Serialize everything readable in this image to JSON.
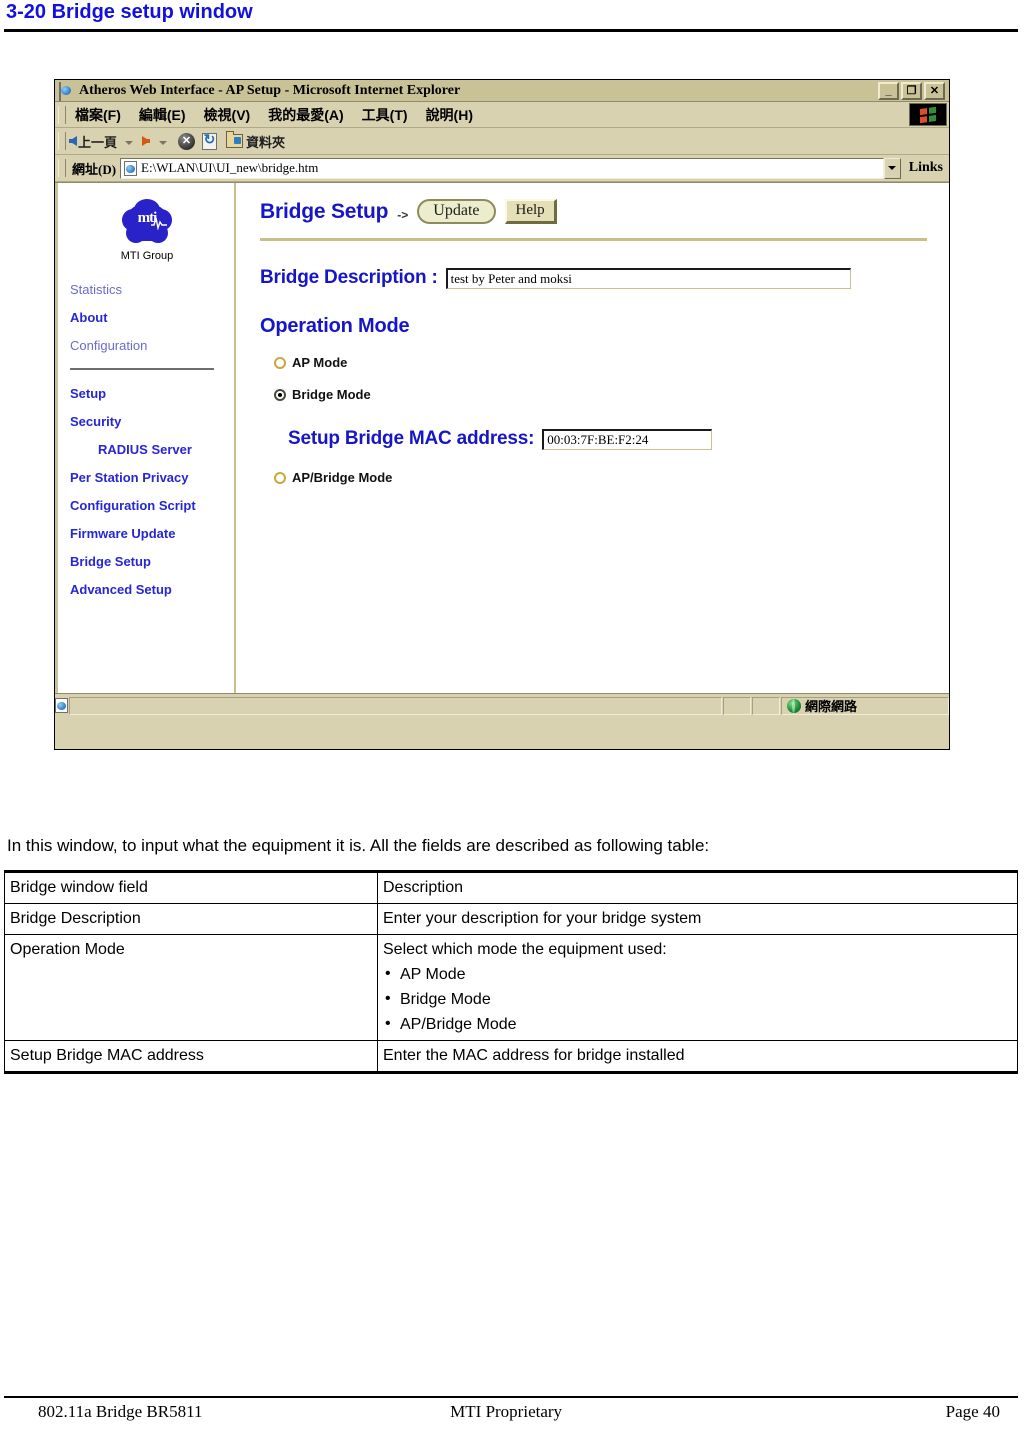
{
  "document": {
    "heading": "3-20 Bridge setup window",
    "intro": "In this window, to input what the equipment it is. All the fields are described as following table:"
  },
  "browser": {
    "title": "Atheros Web Interface - AP Setup - Microsoft Internet Explorer",
    "window_buttons": {
      "minimize": "_",
      "restore": "❐",
      "close": "✕"
    },
    "menu": [
      {
        "label": "檔案(F)"
      },
      {
        "label": "編輯(E)"
      },
      {
        "label": "檢視(V)"
      },
      {
        "label": "我的最愛(A)"
      },
      {
        "label": "工具(T)"
      },
      {
        "label": "說明(H)"
      }
    ],
    "toolbar": {
      "back_label": "上一頁",
      "forward_label": "",
      "stop_label": "✕",
      "refresh_label": "",
      "folders_label": "資料夾"
    },
    "address": {
      "label": "網址(D)",
      "value": "E:\\WLAN\\UI\\UI_new\\bridge.htm",
      "links_label": "Links"
    },
    "statusbar": {
      "zone": "網際網路"
    }
  },
  "sidebar": {
    "logo_text": "mti",
    "logo_label": "MTI Group",
    "items": [
      {
        "label": "Statistics",
        "style": "light"
      },
      {
        "label": "About",
        "style": "bold"
      },
      {
        "label": "Configuration",
        "style": "light"
      },
      {
        "label": "Setup",
        "style": "bold"
      },
      {
        "label": "Security",
        "style": "bold"
      },
      {
        "label": "RADIUS Server",
        "style": "bold indent"
      },
      {
        "label": "Per Station Privacy",
        "style": "bold"
      },
      {
        "label": "Configuration Script",
        "style": "bold"
      },
      {
        "label": "Firmware Update",
        "style": "bold"
      },
      {
        "label": "Bridge Setup",
        "style": "bold"
      },
      {
        "label": "Advanced Setup",
        "style": "bold"
      }
    ]
  },
  "page": {
    "title": "Bridge Setup",
    "title_arrow": "->",
    "update_label": "Update",
    "help_label": "Help",
    "description_label": "Bridge Description :",
    "description_value": "test by Peter and moksi",
    "operation_mode_label": "Operation Mode",
    "modes": [
      {
        "label": "AP Mode",
        "selected": false
      },
      {
        "label": "Bridge Mode",
        "selected": true
      },
      {
        "label": "AP/Bridge Mode",
        "selected": false
      }
    ],
    "mac_label": "Setup Bridge MAC address:",
    "mac_value": "00:03:7F:BE:F2:24"
  },
  "table": {
    "headers": [
      "Bridge window field",
      "Description"
    ],
    "rows": [
      {
        "field": "Bridge Description",
        "description": "Enter your description for your bridge system",
        "bullets": []
      },
      {
        "field": "Operation Mode",
        "description": "Select which mode the equipment used:",
        "bullets": [
          "AP Mode",
          "Bridge Mode",
          "AP/Bridge Mode"
        ]
      },
      {
        "field": "Setup Bridge MAC address",
        "description": "Enter the MAC address for bridge installed",
        "bullets": []
      }
    ]
  },
  "footer": {
    "left": "802.11a Bridge BR5811",
    "center": "MTI Proprietary",
    "right": "Page 40"
  },
  "colors": {
    "heading_blue": "#1010e0",
    "ui_blue": "#1616c8",
    "chrome_tan": "#d8d2b0",
    "rule_olive": "#c9bf8c"
  }
}
